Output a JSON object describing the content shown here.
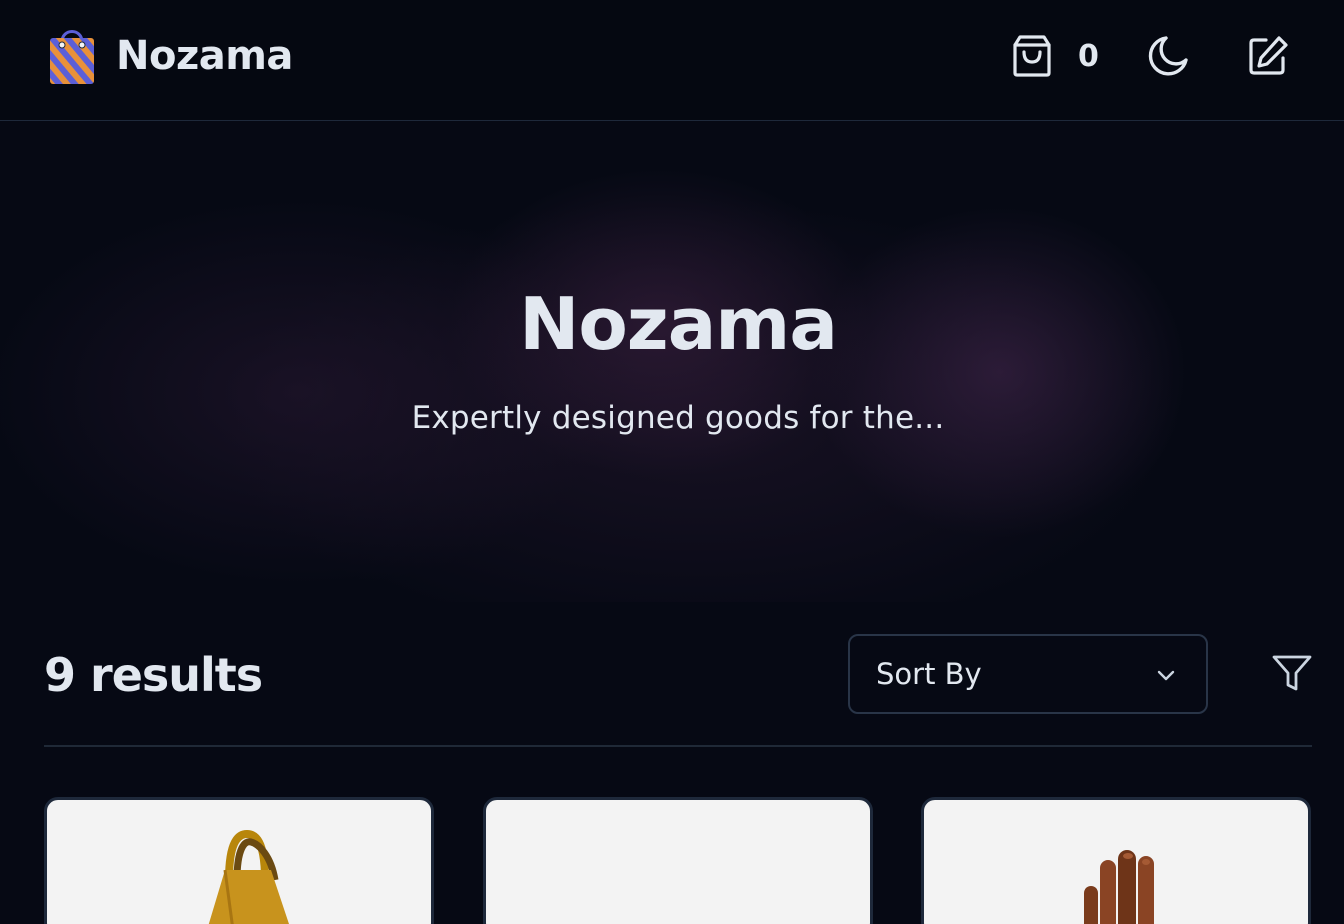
{
  "header": {
    "logo_text": "Nozama",
    "logo_icon": "shopping-bag-icon",
    "cart_icon": "shopping-bag-outline-icon",
    "cart_count": "0",
    "theme_icon": "moon-icon",
    "edit_icon": "edit-icon"
  },
  "hero": {
    "title": "Nozama",
    "subtitle": "Expertly designed goods for the..."
  },
  "results": {
    "count_label": "9 results",
    "sort_label": "Sort By",
    "filter_icon": "filter-icon"
  },
  "products": [
    {
      "image": "tote-bag-image"
    },
    {
      "image": "blank-product-image"
    },
    {
      "image": "leather-glove-image"
    }
  ],
  "colors": {
    "background": "#060914",
    "text": "#e2e8f0",
    "border": "#1e293b",
    "logo_blue": "#5b5fd8",
    "logo_orange": "#e8913a"
  }
}
